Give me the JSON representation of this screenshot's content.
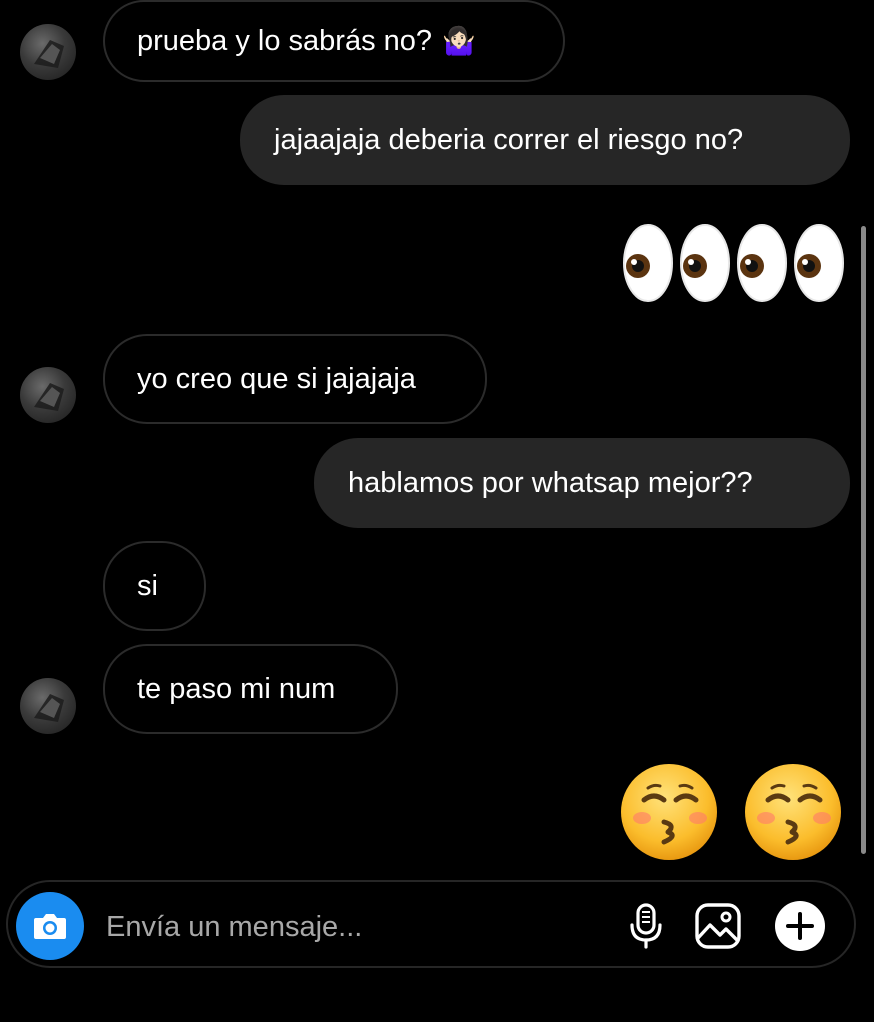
{
  "messages": [
    {
      "side": "in",
      "text": "prueba y lo sabrás no?",
      "emoji": "🤷🏻‍♀️"
    },
    {
      "side": "out",
      "text": "jajaajaja deberia correr el riesgo no?"
    },
    {
      "side": "out",
      "emoji_only": "👀👀"
    },
    {
      "side": "in",
      "text": "yo creo que si jajajaja"
    },
    {
      "side": "out",
      "text": "hablamos por whatsap mejor??"
    },
    {
      "side": "in",
      "text": "si"
    },
    {
      "side": "in",
      "text": "te paso mi num"
    },
    {
      "side": "out",
      "emoji_only": "😚😚"
    }
  ],
  "composer": {
    "placeholder": "Envía un mensaje...",
    "icons": [
      "camera-icon",
      "microphone-icon",
      "gallery-icon",
      "plus-icon"
    ]
  },
  "colors": {
    "background": "#000000",
    "outgoing_bubble": "#262626",
    "incoming_border": "#2b2b2b",
    "camera_button": "#1a8cf0",
    "placeholder": "#a8a8a8"
  }
}
